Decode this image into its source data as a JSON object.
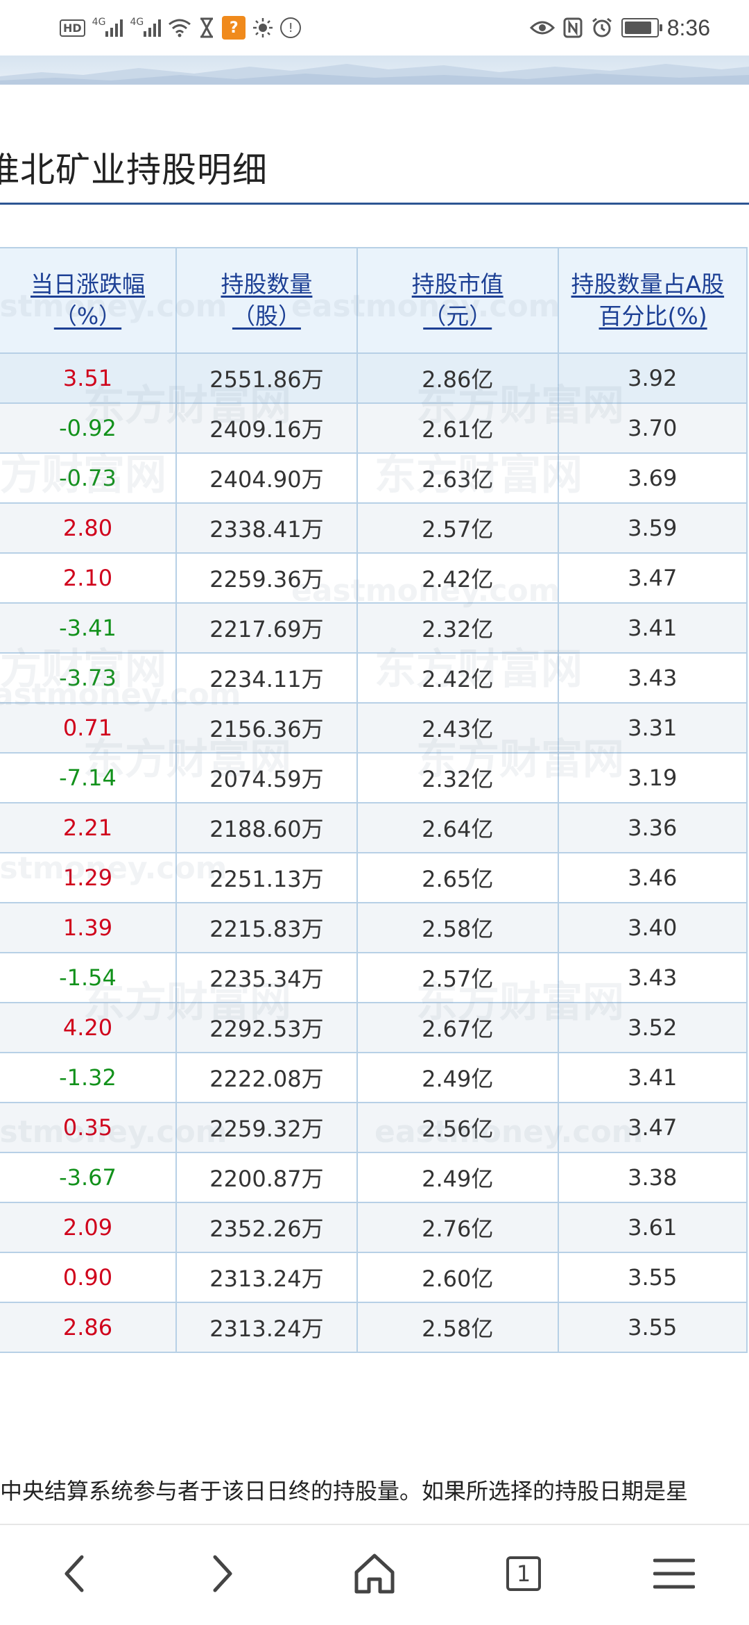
{
  "status_bar": {
    "hd_label": "HD",
    "net1": "4G",
    "net2": "4G",
    "time": "8:36",
    "icons": [
      "hd-icon",
      "signal-icon",
      "signal-icon",
      "wifi-icon",
      "hourglass-icon",
      "app-notification-icon",
      "brightness-icon",
      "alert-icon",
      "eye-icon",
      "nfc-icon",
      "alarm-icon",
      "battery-icon"
    ],
    "orange_badge": "?"
  },
  "page": {
    "title": "淮北矿业持股明细"
  },
  "table": {
    "headers": [
      {
        "line1": "当日涨跌幅",
        "line2": "（%）"
      },
      {
        "line1": "持股数量",
        "line2": "（股）"
      },
      {
        "line1": "持股市值",
        "line2": "（元）"
      },
      {
        "line1": "持股数量占A股",
        "line2": "百分比(%)"
      }
    ],
    "rows": [
      {
        "change": "3.51",
        "dir": "up",
        "shares": "2551.86万",
        "value": "2.86亿",
        "pct": "3.92"
      },
      {
        "change": "-0.92",
        "dir": "down",
        "shares": "2409.16万",
        "value": "2.61亿",
        "pct": "3.70"
      },
      {
        "change": "-0.73",
        "dir": "down",
        "shares": "2404.90万",
        "value": "2.63亿",
        "pct": "3.69"
      },
      {
        "change": "2.80",
        "dir": "up",
        "shares": "2338.41万",
        "value": "2.57亿",
        "pct": "3.59"
      },
      {
        "change": "2.10",
        "dir": "up",
        "shares": "2259.36万",
        "value": "2.42亿",
        "pct": "3.47"
      },
      {
        "change": "-3.41",
        "dir": "down",
        "shares": "2217.69万",
        "value": "2.32亿",
        "pct": "3.41"
      },
      {
        "change": "-3.73",
        "dir": "down",
        "shares": "2234.11万",
        "value": "2.42亿",
        "pct": "3.43"
      },
      {
        "change": "0.71",
        "dir": "up",
        "shares": "2156.36万",
        "value": "2.43亿",
        "pct": "3.31"
      },
      {
        "change": "-7.14",
        "dir": "down",
        "shares": "2074.59万",
        "value": "2.32亿",
        "pct": "3.19"
      },
      {
        "change": "2.21",
        "dir": "up",
        "shares": "2188.60万",
        "value": "2.64亿",
        "pct": "3.36"
      },
      {
        "change": "1.29",
        "dir": "up",
        "shares": "2251.13万",
        "value": "2.65亿",
        "pct": "3.46"
      },
      {
        "change": "1.39",
        "dir": "up",
        "shares": "2215.83万",
        "value": "2.58亿",
        "pct": "3.40"
      },
      {
        "change": "-1.54",
        "dir": "down",
        "shares": "2235.34万",
        "value": "2.57亿",
        "pct": "3.43"
      },
      {
        "change": "4.20",
        "dir": "up",
        "shares": "2292.53万",
        "value": "2.67亿",
        "pct": "3.52"
      },
      {
        "change": "-1.32",
        "dir": "down",
        "shares": "2222.08万",
        "value": "2.49亿",
        "pct": "3.41"
      },
      {
        "change": "0.35",
        "dir": "up",
        "shares": "2259.32万",
        "value": "2.56亿",
        "pct": "3.47"
      },
      {
        "change": "-3.67",
        "dir": "down",
        "shares": "2200.87万",
        "value": "2.49亿",
        "pct": "3.38"
      },
      {
        "change": "2.09",
        "dir": "up",
        "shares": "2352.26万",
        "value": "2.76亿",
        "pct": "3.61"
      },
      {
        "change": "0.90",
        "dir": "up",
        "shares": "2313.24万",
        "value": "2.60亿",
        "pct": "3.55"
      },
      {
        "change": "2.86",
        "dir": "up",
        "shares": "2313.24万",
        "value": "2.58亿",
        "pct": "3.55"
      }
    ],
    "colors": {
      "up": "#d0021b",
      "down": "#12911b",
      "header_text": "#1c3f94",
      "border": "#b7d0e6"
    }
  },
  "watermark": {
    "cn": "东方财富网",
    "en": "eastmoney.com"
  },
  "footnote": "中央结算系统参与者于该日日终的持股量。如果所选择的持股日期是星",
  "bottom_nav": {
    "back": "back-icon",
    "forward": "forward-icon",
    "home": "home-icon",
    "tabs_count": "1",
    "menu": "menu-icon"
  }
}
